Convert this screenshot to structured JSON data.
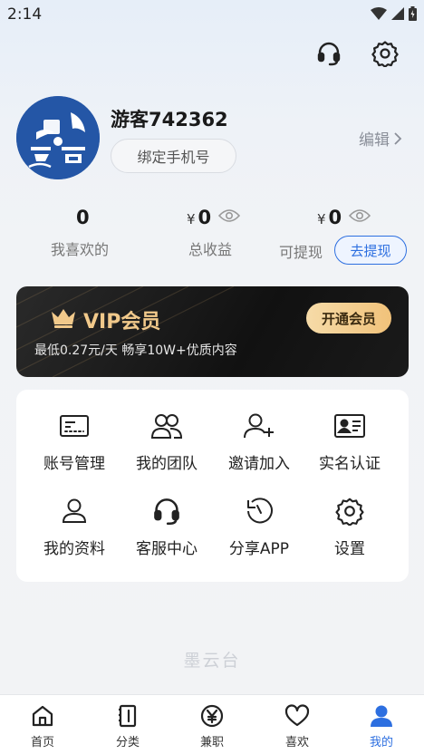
{
  "status_bar": {
    "time": "2:14"
  },
  "profile": {
    "username": "游客742362",
    "bind_phone_label": "绑定手机号",
    "edit_label": "编辑"
  },
  "stats": {
    "liked": {
      "value": "0",
      "label": "我喜欢的"
    },
    "total_income": {
      "currency": "¥",
      "value": "0",
      "label": "总收益"
    },
    "withdrawable": {
      "currency": "¥",
      "value": "0",
      "label": "可提现"
    },
    "withdraw_button": "去提现"
  },
  "vip": {
    "title": "VIP会员",
    "subtitle": "最低0.27元/天 畅享10W+优质内容",
    "open_button": "开通会员"
  },
  "menu": [
    {
      "label": "账号管理",
      "icon": "id-card-icon"
    },
    {
      "label": "我的团队",
      "icon": "team-icon"
    },
    {
      "label": "邀请加入",
      "icon": "add-user-icon"
    },
    {
      "label": "实名认证",
      "icon": "verify-card-icon"
    },
    {
      "label": "我的资料",
      "icon": "profile-icon"
    },
    {
      "label": "客服中心",
      "icon": "headset-icon"
    },
    {
      "label": "分享APP",
      "icon": "share-refresh-icon"
    },
    {
      "label": "设置",
      "icon": "gear-icon"
    }
  ],
  "brand_footer": "墨云台",
  "tabs": [
    {
      "label": "首页",
      "icon": "home-icon"
    },
    {
      "label": "分类",
      "icon": "category-icon"
    },
    {
      "label": "兼职",
      "icon": "yen-icon"
    },
    {
      "label": "喜欢",
      "icon": "heart-icon"
    },
    {
      "label": "我的",
      "icon": "user-icon",
      "active": true
    }
  ],
  "colors": {
    "accent": "#2d6fe0",
    "vip_gold": "#f1c98b",
    "avatar_bg": "#2456a6"
  }
}
